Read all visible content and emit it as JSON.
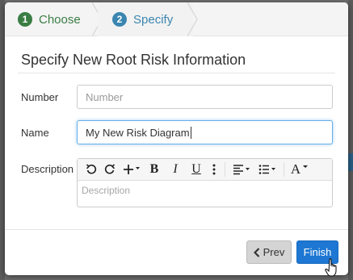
{
  "wizard": {
    "steps": [
      {
        "number": "1",
        "label": "Choose"
      },
      {
        "number": "2",
        "label": "Specify"
      }
    ]
  },
  "form": {
    "title": "Specify New Root Risk Information",
    "number": {
      "label": "Number",
      "placeholder": "Number",
      "value": ""
    },
    "name": {
      "label": "Name",
      "value": "My New Risk Diagram"
    },
    "description": {
      "label": "Description",
      "placeholder": "Description"
    }
  },
  "toolbar": {
    "icons": [
      "undo-icon",
      "redo-icon",
      "insert-plus-icon",
      "bold-icon",
      "italic-icon",
      "underline-icon",
      "more-icon",
      "align-icon",
      "list-icon",
      "font-icon"
    ],
    "bold": "B",
    "italic": "I",
    "underline": "U",
    "font": "A"
  },
  "footer": {
    "prev_label": "Prev",
    "finish_label": "Finish"
  },
  "colors": {
    "step1": "#3a7d44",
    "step2": "#3b86b0",
    "primary": "#1e77d2"
  }
}
